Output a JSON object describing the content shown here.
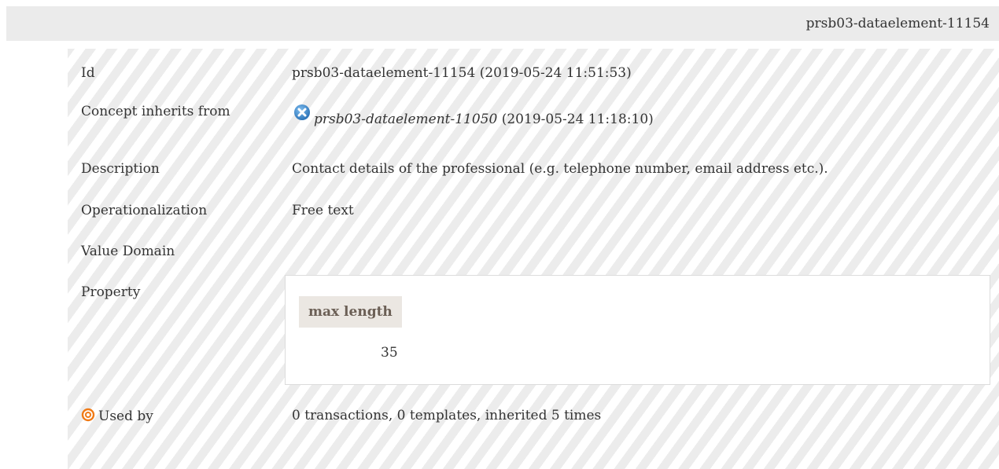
{
  "header": {
    "id_text": "prsb03-dataelement-11154"
  },
  "rows": {
    "id": {
      "label": "Id",
      "value": "prsb03-dataelement-11154 (2019-05-24 11:51:53)"
    },
    "inherits": {
      "label": "Concept inherits from",
      "link": "prsb03-dataelement-11050",
      "date": "(2019-05-24 11:18:10)",
      "icon": "circle-x-icon"
    },
    "description": {
      "label": "Description",
      "value": "Contact details of the professional (e.g. telephone number, email address etc.)."
    },
    "operationalization": {
      "label": "Operationalization",
      "value": "Free text"
    },
    "value_domain": {
      "label": "Value Domain",
      "value": ""
    },
    "property": {
      "label": "Property",
      "column_header": "max length",
      "column_value": "35"
    },
    "used_by": {
      "label": "Used by",
      "value": "0 transactions, 0 templates, inherited 5 times",
      "icon": "target-icon"
    }
  },
  "colors": {
    "topbar_bg": "#ebebeb",
    "stripe": "#ececec",
    "icon_blue": "#3b87c8",
    "icon_orange": "#f07a16",
    "prop_header_bg": "#ebe7e2",
    "prop_header_text": "#6b5f55"
  }
}
